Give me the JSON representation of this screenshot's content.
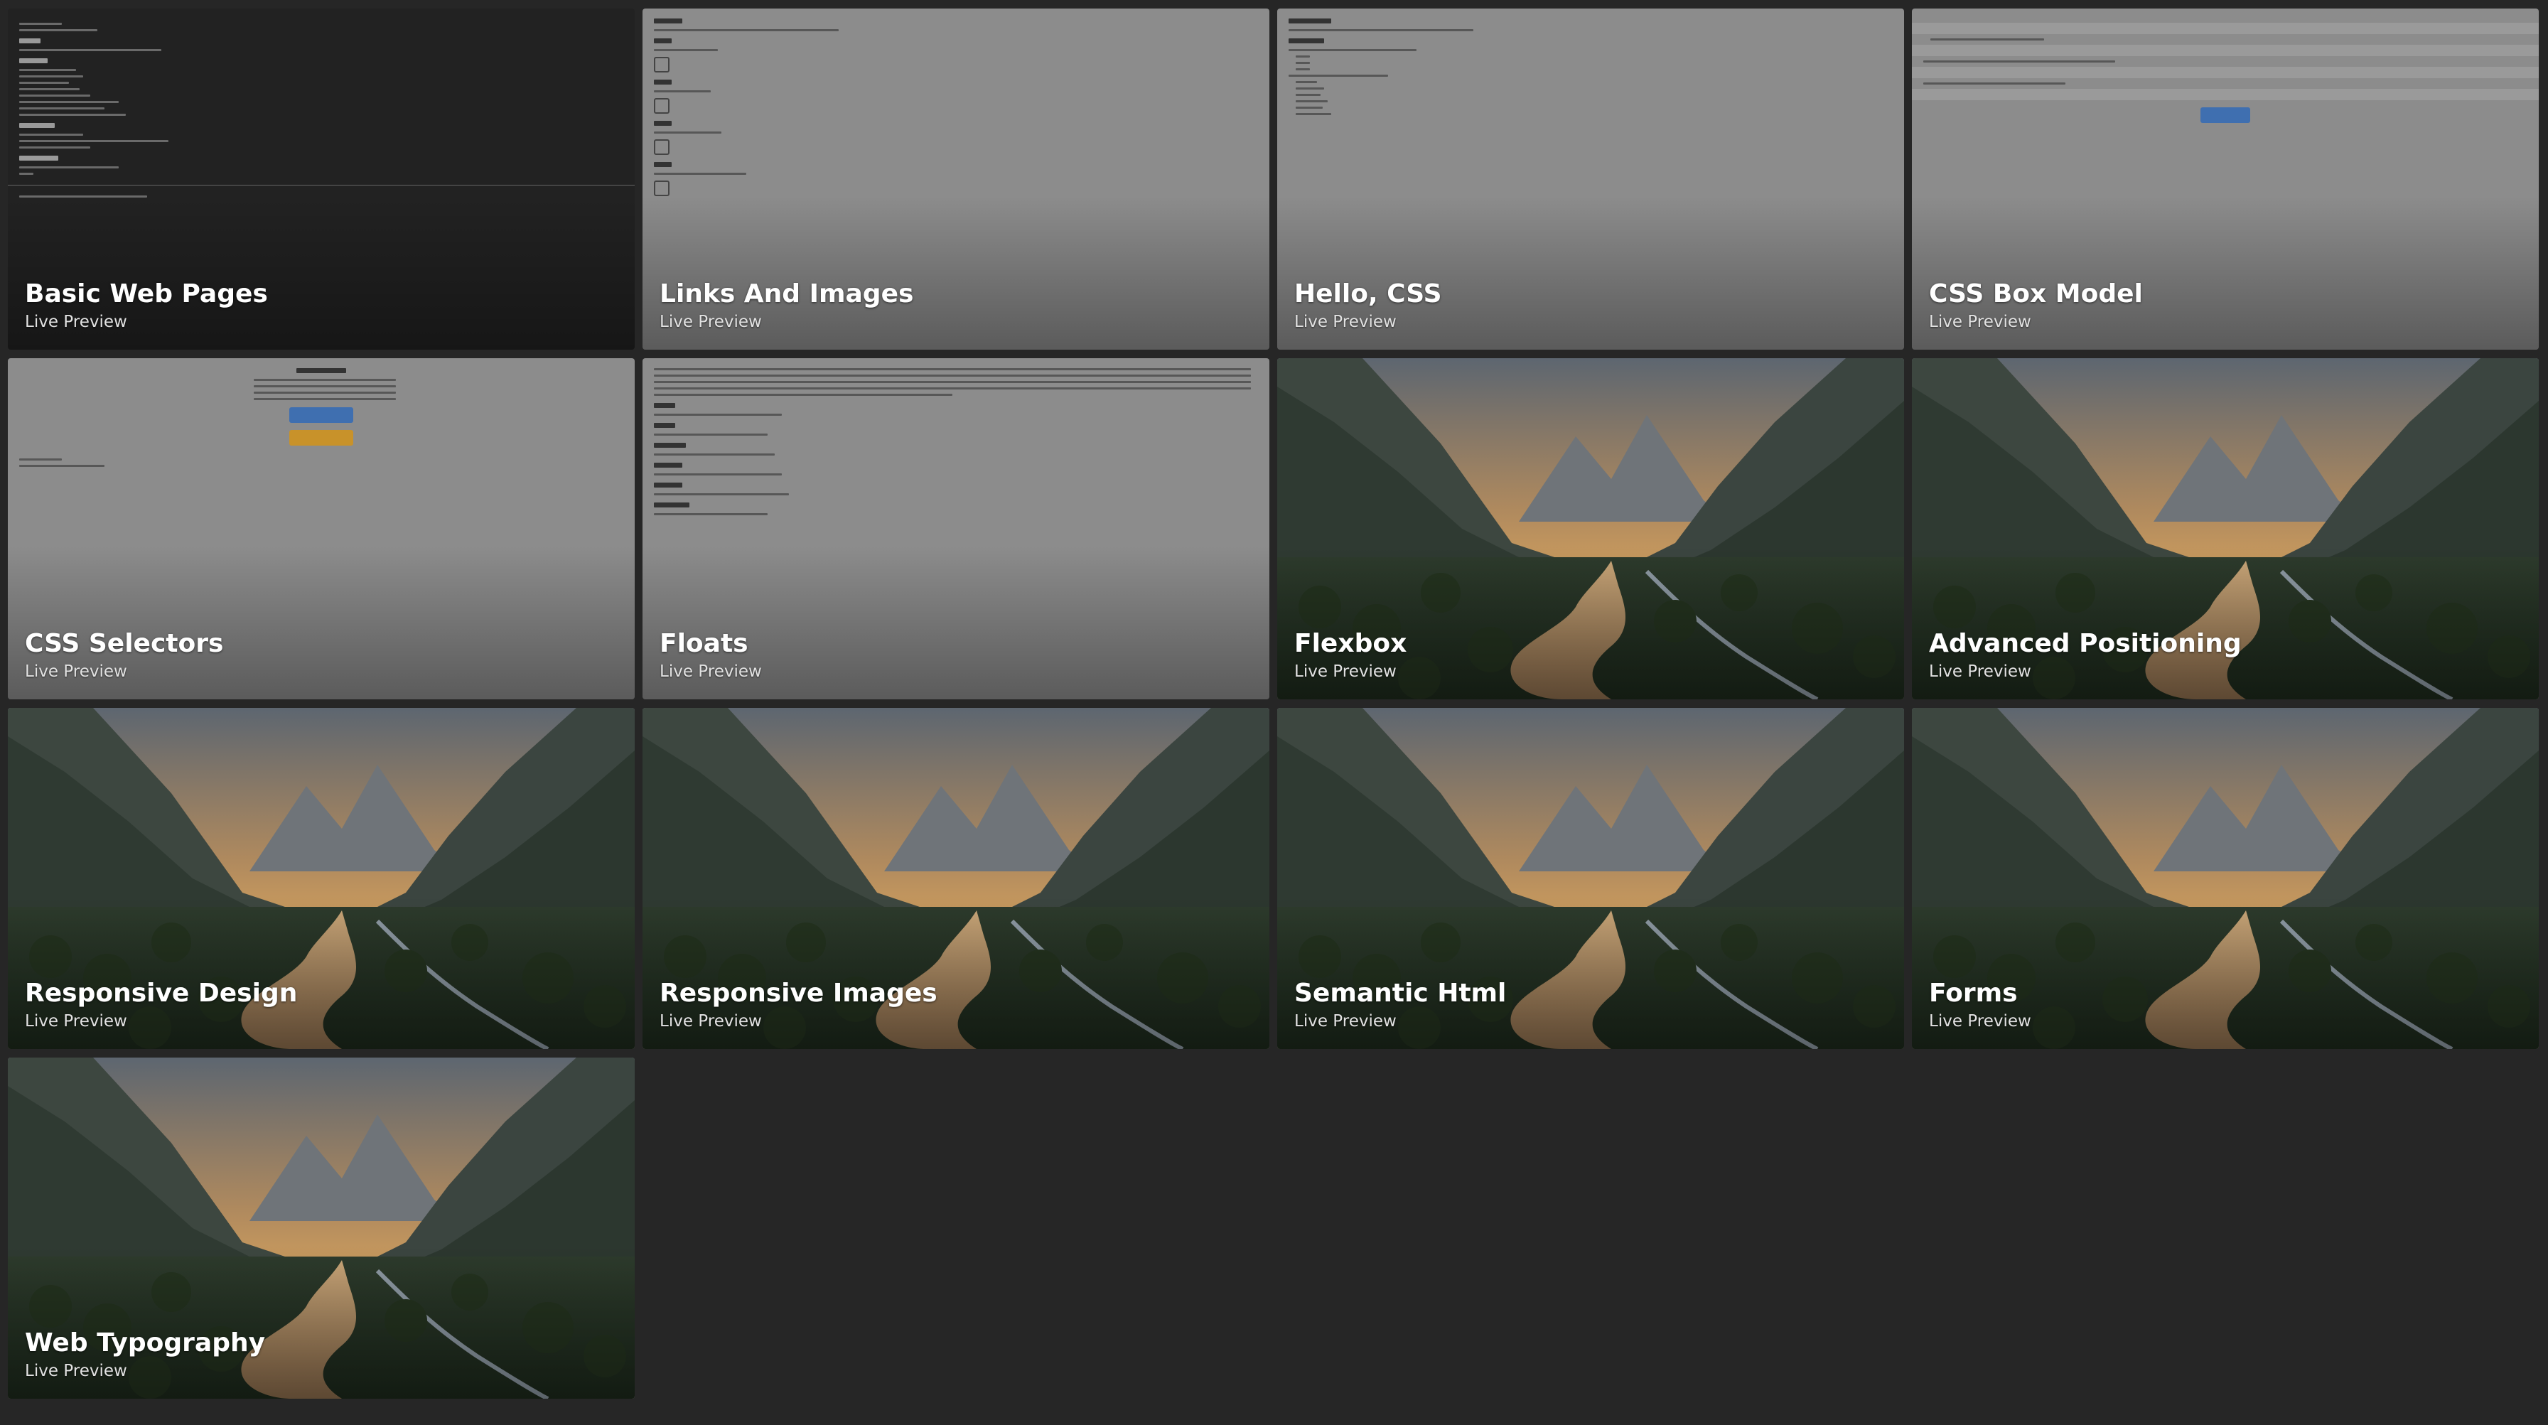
{
  "cards": [
    {
      "title": "Basic Web Pages",
      "subtitle": "Live Preview",
      "thumb": "doc-dark"
    },
    {
      "title": "Links And Images",
      "subtitle": "Live Preview",
      "thumb": "doc-images"
    },
    {
      "title": "Hello, CSS",
      "subtitle": "Live Preview",
      "thumb": "doc-hello"
    },
    {
      "title": "CSS Box Model",
      "subtitle": "Live Preview",
      "thumb": "doc-box"
    },
    {
      "title": "CSS Selectors",
      "subtitle": "Live Preview",
      "thumb": "doc-selectors"
    },
    {
      "title": "Floats",
      "subtitle": "Live Preview",
      "thumb": "doc-floats"
    },
    {
      "title": "Flexbox",
      "subtitle": "Live Preview",
      "thumb": "landscape"
    },
    {
      "title": "Advanced Positioning",
      "subtitle": "Live Preview",
      "thumb": "landscape"
    },
    {
      "title": "Responsive Design",
      "subtitle": "Live Preview",
      "thumb": "landscape"
    },
    {
      "title": "Responsive Images",
      "subtitle": "Live Preview",
      "thumb": "landscape"
    },
    {
      "title": "Semantic Html",
      "subtitle": "Live Preview",
      "thumb": "landscape"
    },
    {
      "title": "Forms",
      "subtitle": "Live Preview",
      "thumb": "landscape"
    },
    {
      "title": "Web Typography",
      "subtitle": "Live Preview",
      "thumb": "landscape"
    }
  ],
  "colors": {
    "background": "#262626",
    "preview_gray": "#8c8c8c",
    "button_blue": "#3f6fb0",
    "button_orange": "#c8922a"
  }
}
